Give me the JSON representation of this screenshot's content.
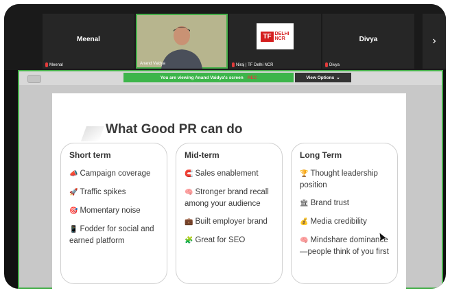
{
  "participants": [
    {
      "name": "Meenal",
      "tag": "Meenal"
    },
    {
      "name": "",
      "tag": "Anand Vaidya",
      "active": true
    },
    {
      "name": "",
      "tag": "Niraj | TF Delhi NCR",
      "logo": {
        "tf": "TF",
        "line1": "DELHI",
        "line2": "NCR"
      }
    },
    {
      "name": "Divya",
      "tag": "Divya"
    }
  ],
  "next_arrow": "›",
  "share_banner": {
    "text": "You are viewing  Anand Vaidya's screen",
    "rec": "REC",
    "view_options": "View Options"
  },
  "slide": {
    "title": "What Good PR can do",
    "columns": [
      {
        "heading": "Short term",
        "items": [
          {
            "icon": "megaphone-icon",
            "glyph": "📣",
            "text": "Campaign coverage"
          },
          {
            "icon": "rocket-icon",
            "glyph": "🚀",
            "text": "Traffic spikes"
          },
          {
            "icon": "target-icon",
            "glyph": "🎯",
            "text": "Momentary noise"
          },
          {
            "icon": "phone-icon",
            "glyph": "📱",
            "text": "Fodder for social and earned platform"
          }
        ]
      },
      {
        "heading": "Mid-term",
        "items": [
          {
            "icon": "magnet-icon",
            "glyph": "🧲",
            "text": "Sales enablement"
          },
          {
            "icon": "brain-icon",
            "glyph": "🧠",
            "text": "Stronger brand recall among your audience"
          },
          {
            "icon": "briefcase-icon",
            "glyph": "💼",
            "text": "Built employer brand"
          },
          {
            "icon": "puzzle-icon",
            "glyph": "🧩",
            "text": "Great for SEO"
          }
        ]
      },
      {
        "heading": "Long Term",
        "items": [
          {
            "icon": "trophy-icon",
            "glyph": "🏆",
            "text": "Thought leadership position"
          },
          {
            "icon": "bank-icon",
            "glyph": "🏛",
            "text": "Brand trust"
          },
          {
            "icon": "money-bag-icon",
            "glyph": "💰",
            "text": "Media credibility"
          },
          {
            "icon": "brain-icon",
            "glyph": "🧠",
            "text": "Mindshare dominance—people think of you first"
          }
        ]
      }
    ]
  }
}
